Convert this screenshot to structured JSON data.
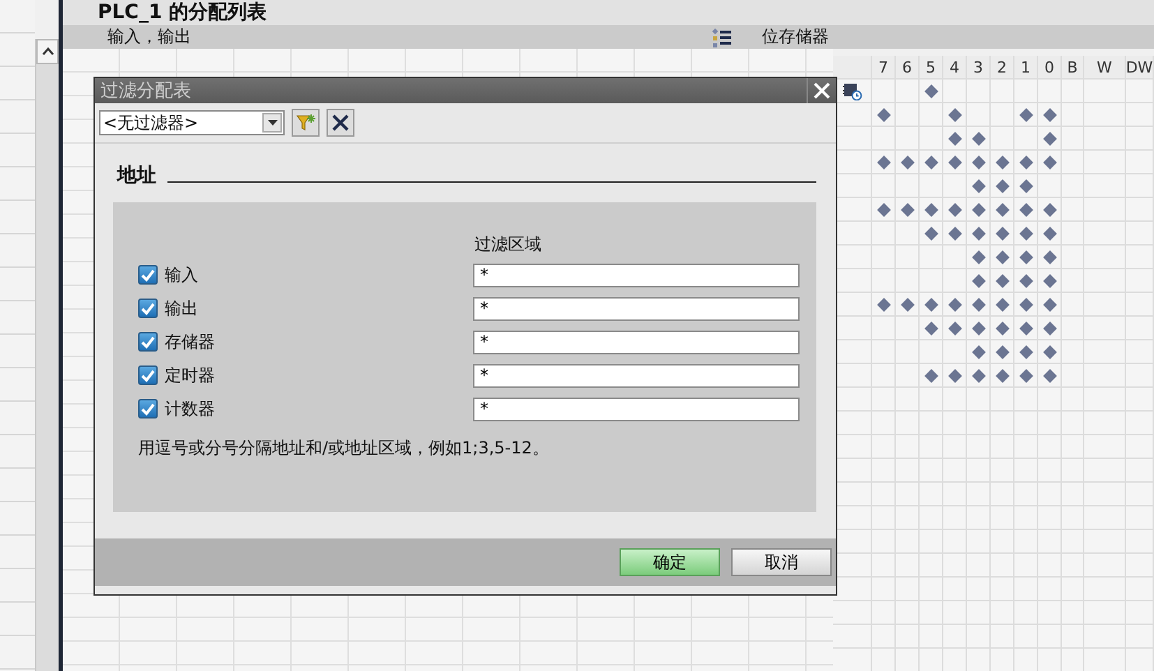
{
  "editor": {
    "title": "PLC_1 的分配列表",
    "inputs_header": "输入，输出",
    "memory_header": "位存储器"
  },
  "bit_grid": {
    "columns": [
      "7",
      "6",
      "5",
      "4",
      "3",
      "2",
      "1",
      "0",
      "B",
      "W",
      "DW"
    ],
    "rows": [
      {
        "has_icon": true,
        "bits": [
          false,
          false,
          true,
          false,
          false,
          false,
          false,
          false
        ]
      },
      {
        "has_icon": false,
        "bits": [
          true,
          false,
          false,
          true,
          false,
          false,
          true,
          true
        ]
      },
      {
        "has_icon": false,
        "bits": [
          false,
          false,
          false,
          true,
          true,
          false,
          false,
          true
        ]
      },
      {
        "has_icon": false,
        "bits": [
          true,
          true,
          true,
          true,
          true,
          true,
          true,
          true
        ]
      },
      {
        "has_icon": false,
        "bits": [
          false,
          false,
          false,
          false,
          true,
          true,
          true,
          false
        ]
      },
      {
        "has_icon": false,
        "bits": [
          true,
          true,
          true,
          true,
          true,
          true,
          true,
          true
        ]
      },
      {
        "has_icon": false,
        "bits": [
          false,
          false,
          true,
          true,
          true,
          true,
          true,
          true
        ]
      },
      {
        "has_icon": false,
        "bits": [
          false,
          false,
          false,
          false,
          true,
          true,
          true,
          true
        ]
      },
      {
        "has_icon": false,
        "bits": [
          false,
          false,
          false,
          false,
          true,
          true,
          true,
          true
        ]
      },
      {
        "has_icon": false,
        "bits": [
          true,
          true,
          true,
          true,
          true,
          true,
          true,
          true
        ]
      },
      {
        "has_icon": false,
        "bits": [
          false,
          false,
          true,
          true,
          true,
          true,
          true,
          true
        ]
      },
      {
        "has_icon": false,
        "bits": [
          false,
          false,
          false,
          false,
          true,
          true,
          true,
          true
        ]
      },
      {
        "has_icon": false,
        "bits": [
          false,
          false,
          true,
          true,
          true,
          true,
          true,
          true
        ]
      }
    ]
  },
  "dialog": {
    "title": "过滤分配表",
    "filter_select": "<无过滤器>",
    "section": "地址",
    "range_header": "过滤区域",
    "rows": [
      {
        "label": "输入",
        "checked": true,
        "value": "*"
      },
      {
        "label": "输出",
        "checked": true,
        "value": "*"
      },
      {
        "label": "存储器",
        "checked": true,
        "value": "*"
      },
      {
        "label": "定时器",
        "checked": true,
        "value": "*"
      },
      {
        "label": "计数器",
        "checked": true,
        "value": "*"
      }
    ],
    "hint": "用逗号或分号分隔地址和/或地址区域，例如1;3,5-12。",
    "buttons": [
      {
        "label": "确定",
        "kind": "primary"
      },
      {
        "label": "取消",
        "kind": "normal"
      }
    ]
  }
}
